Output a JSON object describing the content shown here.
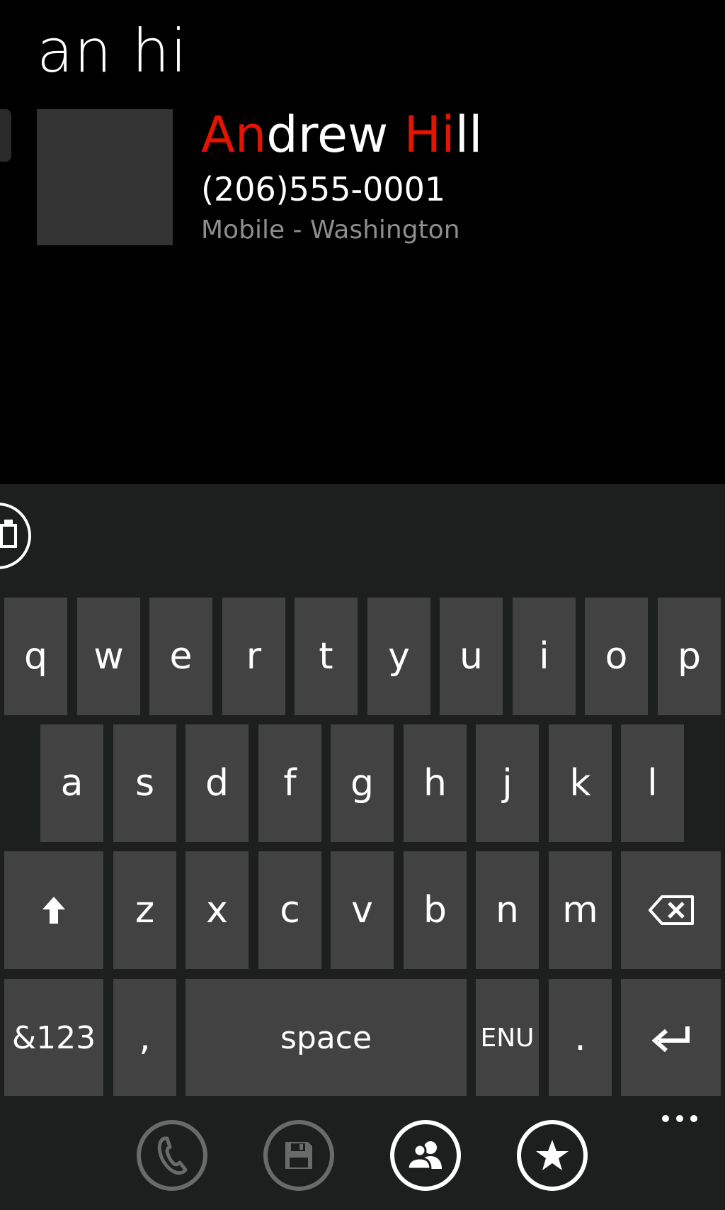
{
  "search": {
    "query": "an hi"
  },
  "contact": {
    "name_parts": [
      {
        "text": "An",
        "highlight": true
      },
      {
        "text": "drew ",
        "highlight": false
      },
      {
        "text": "Hi",
        "highlight": true
      },
      {
        "text": "ll",
        "highlight": false
      }
    ],
    "phone": "(206)555-0001",
    "detail": "Mobile - Washington"
  },
  "keyboard": {
    "row1": [
      "q",
      "w",
      "e",
      "r",
      "t",
      "y",
      "u",
      "i",
      "o",
      "p"
    ],
    "row2": [
      "a",
      "s",
      "d",
      "f",
      "g",
      "h",
      "j",
      "k",
      "l"
    ],
    "row3": [
      "z",
      "x",
      "c",
      "v",
      "b",
      "n",
      "m"
    ],
    "row4": {
      "symbols": "&123",
      "comma": ",",
      "space": "space",
      "language": "ENU",
      "period": "."
    }
  },
  "appbar": {
    "buttons": [
      {
        "name": "phone-icon",
        "enabled": false
      },
      {
        "name": "save-icon",
        "enabled": false
      },
      {
        "name": "people-icon",
        "enabled": true
      },
      {
        "name": "star-icon",
        "enabled": true
      }
    ]
  },
  "colors": {
    "background": "#000000",
    "highlight": "#e51400",
    "key": "#424242",
    "keyboard_bg": "#1c1f1d",
    "secondary_text": "#8e8e8e"
  }
}
